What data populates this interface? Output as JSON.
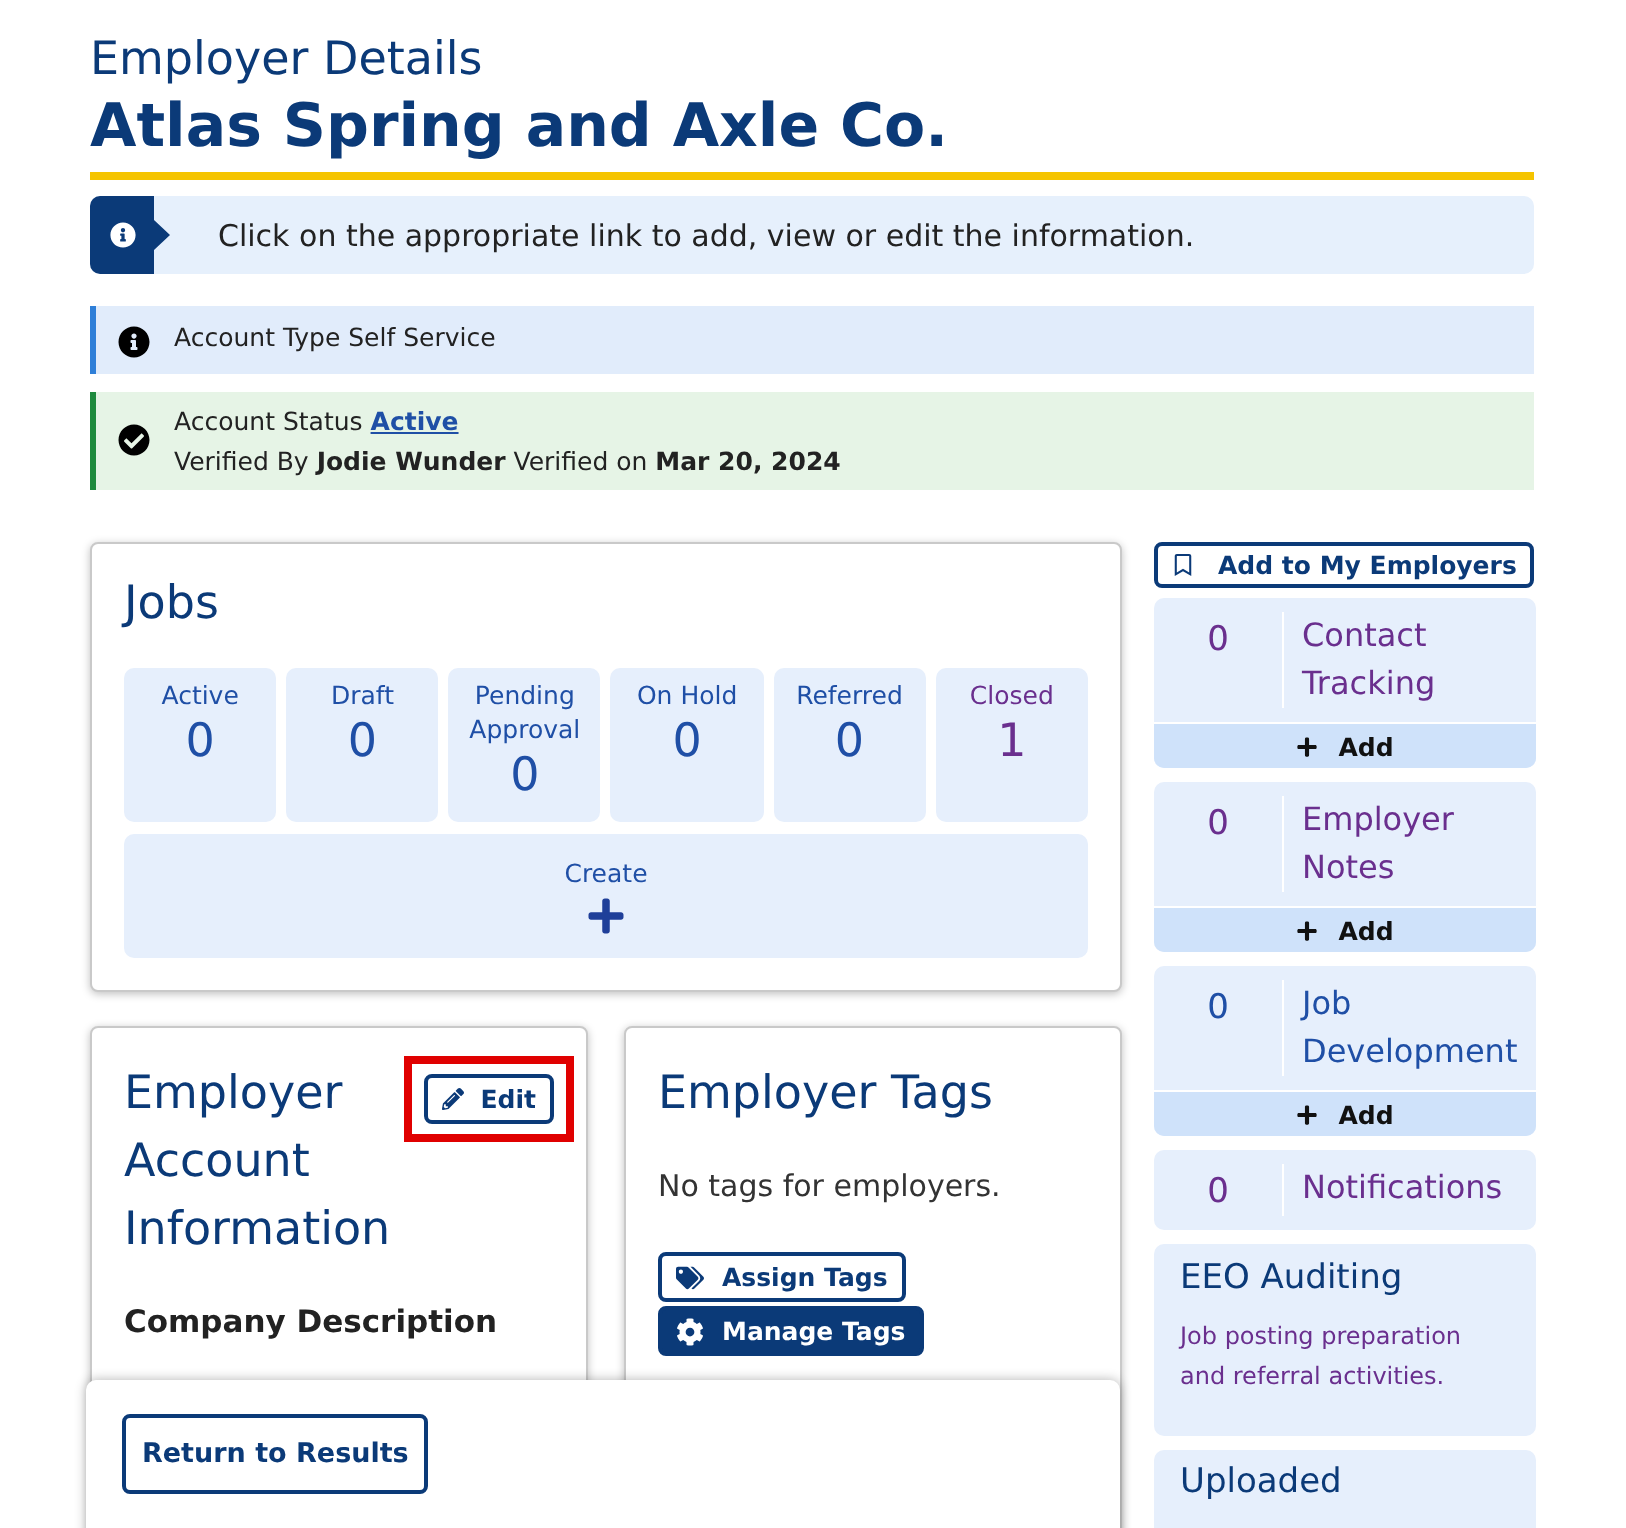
{
  "header": {
    "subtitle": "Employer Details",
    "title": "Atlas Spring and Axle Co."
  },
  "instruction": "Click on the appropriate link to add, view or edit the information.",
  "alerts": [
    {
      "kind": "info",
      "label": "Account Type Self Service"
    },
    {
      "kind": "success",
      "label": "Account Status",
      "link": "Active",
      "detail": "Verified By **Jodie Wunder** Verified on **Mar 20, 2024**"
    }
  ],
  "jobs": {
    "title": "Jobs",
    "create": "Create",
    "counts": [
      {
        "label": "Active",
        "value": "0",
        "visited": false
      },
      {
        "label": "Draft",
        "value": "0",
        "visited": false
      },
      {
        "label": "Pending Approval",
        "value": "0",
        "visited": false
      },
      {
        "label": "On Hold",
        "value": "0",
        "visited": false
      },
      {
        "label": "Referred",
        "value": "0",
        "visited": false
      },
      {
        "label": "Closed",
        "value": "1",
        "visited": true
      }
    ]
  },
  "account_card": {
    "title": "Employer Account Information",
    "edit": {
      "label": "Edit",
      "highlighted": true
    },
    "section": "Company Description"
  },
  "tags_card": {
    "title": "Employer Tags",
    "empty": "No tags for employers.",
    "buttons": [
      {
        "label": "Assign Tags",
        "kind": "outline"
      },
      {
        "label": "Manage Tags",
        "kind": "solid"
      }
    ]
  },
  "sidebar": {
    "bookmark": "Add to My Employers",
    "trackers": [
      {
        "count": "0",
        "label": "Contact Tracking",
        "visited": true,
        "add": "Add"
      },
      {
        "count": "0",
        "label": "Employer Notes",
        "visited": true,
        "add": "Add"
      },
      {
        "count": "0",
        "label": "Job Development",
        "visited": false,
        "add": "Add"
      },
      {
        "count": "0",
        "label": "Notifications",
        "visited": true
      }
    ],
    "eeo": {
      "title": "EEO Auditing",
      "text": "Job posting preparation and referral activities."
    },
    "uploaded": "Uploaded"
  },
  "footer": {
    "button": "Return to Results"
  }
}
